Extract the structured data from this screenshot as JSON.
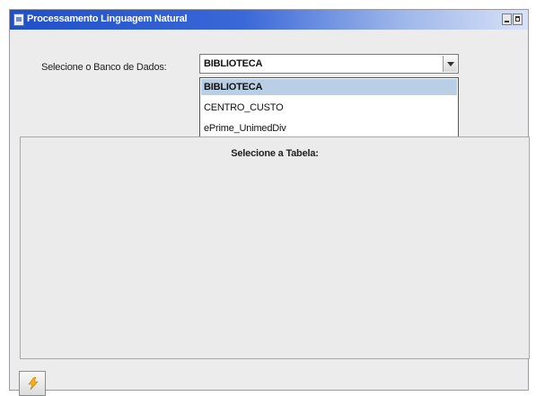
{
  "window": {
    "title": "Processamento Linguagem Natural"
  },
  "database_selector": {
    "label": "Selecione o Banco de Dados:",
    "selected": "BIBLIOTECA",
    "options": [
      "BIBLIOTECA",
      "CENTRO_CUSTO",
      "ePrime_UnimedDiv"
    ]
  },
  "table_panel": {
    "title": "Selecione a Tabela:"
  },
  "icons": {
    "app": "window-app-icon",
    "run": "lightning-icon",
    "combo": "chevron-down-icon"
  },
  "colors": {
    "titlebar": "#1f4fc9",
    "selected_option": "#b8cfe5",
    "run_icon": "#f2b316"
  }
}
